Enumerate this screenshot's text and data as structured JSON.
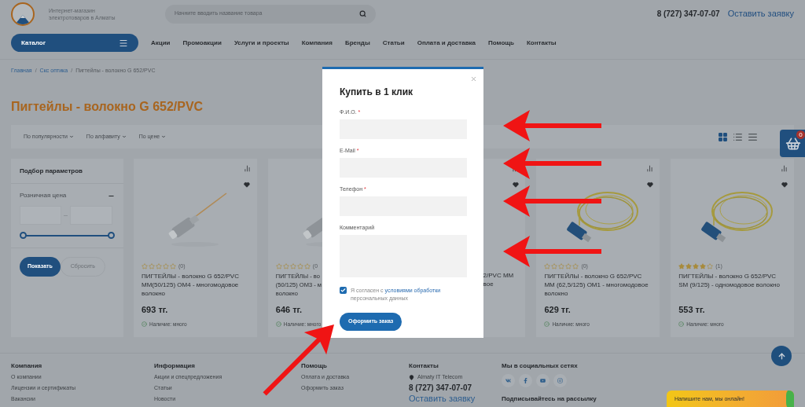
{
  "header": {
    "tagline": "Интернет-магазин электротоваров в Алматы",
    "search": {
      "placeholder": "Начните вводить название товара"
    },
    "phone": "8 (727) 347-07-07",
    "request_link": "Оставить заявку"
  },
  "nav": {
    "catalog": "Каталог",
    "items": [
      "Акции",
      "Промоакции",
      "Услуги и проекты",
      "Компания",
      "Бренды",
      "Статьи",
      "Оплата и доставка",
      "Помощь",
      "Контакты"
    ]
  },
  "breadcrumb_separator": "/",
  "breadcrumbs": [
    {
      "label": "Главная",
      "kind": "link"
    },
    {
      "label": "Скс оптика",
      "kind": "link"
    },
    {
      "label": "Пигтейлы - волокно G 652/PVC",
      "kind": "current"
    }
  ],
  "title": "Пигтейлы - волокно G 652/PVC",
  "sort": [
    "По популярности",
    "По алфавиту",
    "По цене"
  ],
  "view_modes": [
    {
      "kind": "grid",
      "selected": true
    },
    {
      "kind": "list",
      "selected": false
    },
    {
      "kind": "table",
      "selected": false
    }
  ],
  "cart": {
    "count": "0"
  },
  "filter": {
    "title": "Подбор параметров",
    "price_label": "Розничная цена",
    "expanded": true,
    "price_range": [
      {
        "level": 0
      },
      {
        "level": 1
      }
    ],
    "show": "Показать",
    "reset": "Сбросить"
  },
  "products": [
    {
      "kind": "full",
      "stars": 0,
      "reviews": "(0)",
      "name": "ПИГТЕЙЛЫ - волокно G 652/PVC MM(50/125) OM4 - многомодовое волокно",
      "price": "693 тг.",
      "availability": "Наличие: много"
    },
    {
      "kind": "clipped",
      "stars": 0,
      "reviews": "(0",
      "name_lines": [
        "ПИГТЕЙЛЫ - во",
        "(50/125) OM3 - м",
        "волокно"
      ],
      "price": "646 тг.",
      "availability": "Наличие: много"
    },
    {
      "kind": "partial",
      "name_lines": [
        "2/PVC MM",
        "вое"
      ]
    },
    {
      "kind": "full",
      "stars": 0,
      "reviews": "(0)",
      "name": "ПИГТЕЙЛЫ - волокно G 652/PVC MM (62,5/125) OM1 - многомодовое волокно",
      "price": "629 тг.",
      "availability": "Наличие: много"
    },
    {
      "kind": "full",
      "stars": 4,
      "reviews": "(1)",
      "name": "ПИГТЕЙЛЫ - волокно G 652/PVC SM (9/125) - одномодовое волокно",
      "price": "553 тг.",
      "availability": "Наличие: много"
    }
  ],
  "modal": {
    "title": "Купить в 1 клик",
    "fields": [
      {
        "label": "Ф.И.О.",
        "required_mark": "*",
        "kind": "input"
      },
      {
        "label": "E-Mail",
        "required_mark": "*",
        "kind": "input"
      },
      {
        "label": "Телефон",
        "required_mark": "*",
        "kind": "input"
      },
      {
        "label": "Комментарий",
        "kind": "textarea"
      }
    ],
    "consent": {
      "checked": true,
      "before": "Я согласен с ",
      "link": "условиями обработки",
      "after": " персональных данных"
    },
    "submit": "Оформить заказ"
  },
  "footer": {
    "columns": [
      {
        "title": "Компания",
        "links": [
          "О компании",
          "Лицензии и сертификаты",
          "Вакансии"
        ]
      },
      {
        "title": "Информация",
        "links": [
          "Акции и спецпредложения",
          "Статьи",
          "Новости"
        ]
      },
      {
        "title": "Помощь",
        "links": [
          "Оплата и доставка",
          "Оформить заказ"
        ]
      }
    ],
    "contacts": {
      "title": "Контакты",
      "address": "Almaty IT Telecom",
      "phone": "8 (727) 347-07-07",
      "request_link": "Оставить заявку"
    },
    "social": {
      "title": "Мы в социальных сетях",
      "networks": [
        {
          "kind": "vk"
        },
        {
          "kind": "facebook"
        },
        {
          "kind": "youtube"
        },
        {
          "kind": "instagram"
        }
      ],
      "subscribe": "Подписывайтесь на рассылку"
    }
  },
  "chat": "Напишите нам, мы онлайн!"
}
